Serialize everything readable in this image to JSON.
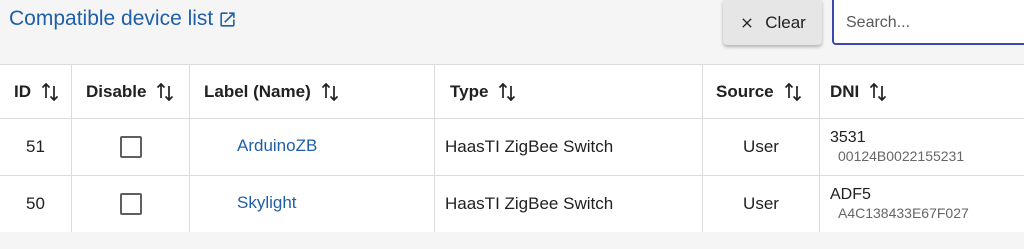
{
  "header": {
    "compatible_link_label": "Compatible device list",
    "clear_label": "Clear",
    "search_placeholder": "Search...",
    "search_value": ""
  },
  "table": {
    "columns": [
      "ID",
      "Disable",
      "Label (Name)",
      "Type",
      "Source",
      "DNI"
    ],
    "rows": [
      {
        "id": "51",
        "disabled": false,
        "label": "ArduinoZB",
        "type": "HaasTI ZigBee Switch",
        "source": "User",
        "dni": "3531",
        "dni_sub": "00124B0022155231"
      },
      {
        "id": "50",
        "disabled": false,
        "label": "Skylight",
        "type": "HaasTI ZigBee Switch",
        "source": "User",
        "dni": "ADF5",
        "dni_sub": "A4C138433E67F027"
      }
    ]
  },
  "icons": {
    "external_link": "open-in-new-icon",
    "clear": "close-icon",
    "sort": "sort-arrows-icon"
  },
  "colors": {
    "link": "#1f5fa8",
    "search_border": "#3b4aa8"
  }
}
